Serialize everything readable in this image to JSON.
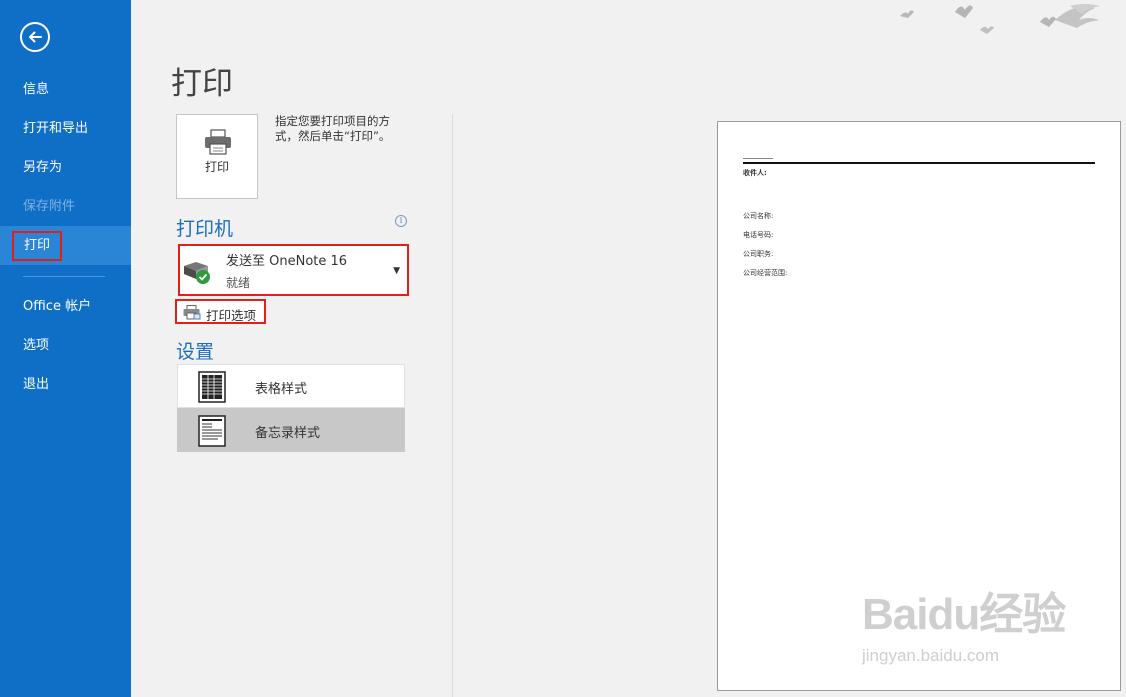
{
  "nav": {
    "items": [
      {
        "label": "信息"
      },
      {
        "label": "打开和导出"
      },
      {
        "label": "另存为"
      },
      {
        "label": "保存附件"
      },
      {
        "label": "打印"
      },
      {
        "label": "Office 帐户"
      },
      {
        "label": "选项"
      },
      {
        "label": "退出"
      }
    ],
    "active": "打印",
    "back_icon": "arrow-left-circle-icon"
  },
  "main": {
    "title": "打印",
    "print_button_label": "打印",
    "print_description": "指定您要打印项目的方式，然后单击“打印”。",
    "printer_section_title": "打印机",
    "printer": {
      "name": "发送至 OneNote 16",
      "status": "就绪"
    },
    "print_options_label": "打印选项",
    "settings_section_title": "设置",
    "styles": [
      {
        "label": "表格样式",
        "selected": false
      },
      {
        "label": "备忘录样式",
        "selected": true
      }
    ]
  },
  "preview": {
    "fields": [
      "收件人:",
      "公司名称:",
      "电话号码:",
      "公司职务:",
      "公司经营范围:"
    ]
  },
  "watermark": {
    "text": "Baidu经验",
    "url": "jingyan.baidu.com"
  },
  "colors": {
    "nav_bg": "#0f6fc6",
    "accent_text": "#1b6ec2",
    "highlight_border": "#e0201a",
    "selected_item": "#c8c8c8"
  }
}
